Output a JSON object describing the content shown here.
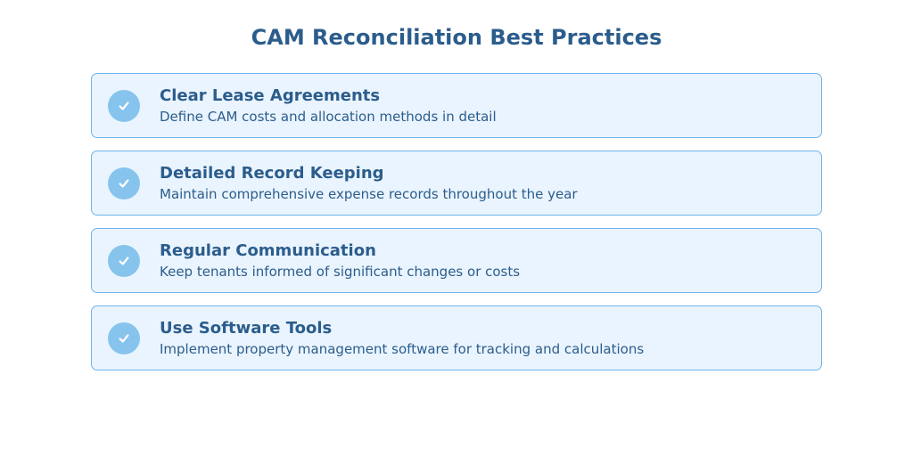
{
  "title": "CAM Reconciliation Best Practices",
  "items": [
    {
      "heading": "Clear Lease Agreements",
      "desc": "Define CAM costs and allocation methods in detail"
    },
    {
      "heading": "Detailed Record Keeping",
      "desc": "Maintain comprehensive expense records throughout the year"
    },
    {
      "heading": "Regular Communication",
      "desc": "Keep tenants informed of significant changes or costs"
    },
    {
      "heading": "Use Software Tools",
      "desc": "Implement property management software for tracking and calculations"
    }
  ],
  "colors": {
    "accent": "#2b5d8c",
    "card_bg": "#eaf4fe",
    "card_border": "#6fb4e8",
    "badge": "#86c4ee"
  }
}
